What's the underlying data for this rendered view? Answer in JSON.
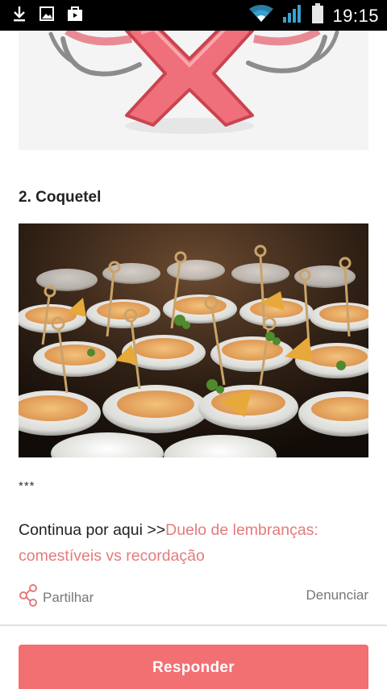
{
  "status_bar": {
    "time": "19:15",
    "left_icons": [
      "download-icon",
      "image-icon",
      "store-icon"
    ],
    "right_icons": [
      "wifi-icon",
      "signal-icon",
      "battery-icon"
    ]
  },
  "post": {
    "section_heading": "2. Coquetel",
    "separator": "***",
    "continue_prefix": "Continua por aqui >>",
    "continue_link": "Duelo de lembranças: comestíveis vs recordação"
  },
  "actions": {
    "share_label": "Partilhar",
    "report_label": "Denunciar"
  },
  "reply_button": {
    "label": "Responder"
  },
  "colors": {
    "accent": "#f26f72",
    "link": "#e47b7b",
    "status_bar": "#000000"
  }
}
